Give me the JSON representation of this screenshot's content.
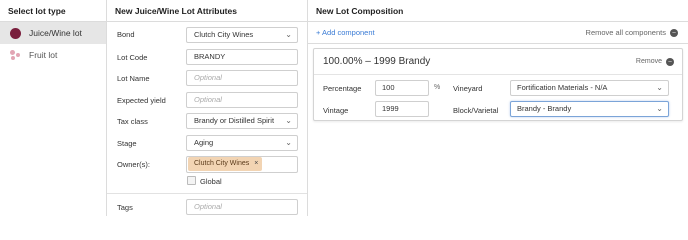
{
  "left": {
    "header": "Select lot type",
    "items": [
      {
        "label": "Juice/Wine lot",
        "selected": true,
        "icon": "wine-dot-icon"
      },
      {
        "label": "Fruit lot",
        "selected": false,
        "icon": "fruit-dots-icon"
      }
    ]
  },
  "middle": {
    "header": "New Juice/Wine Lot Attributes",
    "bond": {
      "label": "Bond",
      "value": "Clutch City Wines"
    },
    "lot_code": {
      "label": "Lot Code",
      "value": "BRANDY"
    },
    "lot_name": {
      "label": "Lot Name",
      "placeholder": "Optional"
    },
    "expected_yield": {
      "label": "Expected yield",
      "placeholder": "Optional"
    },
    "tax_class": {
      "label": "Tax class",
      "value": "Brandy or Distilled Spirit"
    },
    "stage": {
      "label": "Stage",
      "value": "Aging"
    },
    "owners": {
      "label": "Owner(s):",
      "tag": "Clutch City Wines",
      "tag_remove": "×"
    },
    "global": {
      "label": "Global"
    },
    "tags": {
      "label": "Tags",
      "placeholder": "Optional"
    }
  },
  "right": {
    "header": "New Lot Composition",
    "add_component": "+ Add component",
    "remove_all": "Remove all components",
    "component": {
      "title": "100.00%  –  1999 Brandy",
      "remove": "Remove",
      "percentage_label": "Percentage",
      "percentage_value": "100",
      "percentage_unit": "%",
      "vintage_label": "Vintage",
      "vintage_value": "1999",
      "vineyard_label": "Vineyard",
      "vineyard_value": "Fortification Materials - N/A",
      "block_label": "Block/Varietal",
      "block_value": "Brandy - Brandy"
    }
  },
  "colors": {
    "wine_dot": "#7a1f3d",
    "fruit_dots": "#e2a5b4",
    "link": "#3a7bd5",
    "tag_bg": "#f2d4b3",
    "selected_bg": "#e6e6e6"
  }
}
